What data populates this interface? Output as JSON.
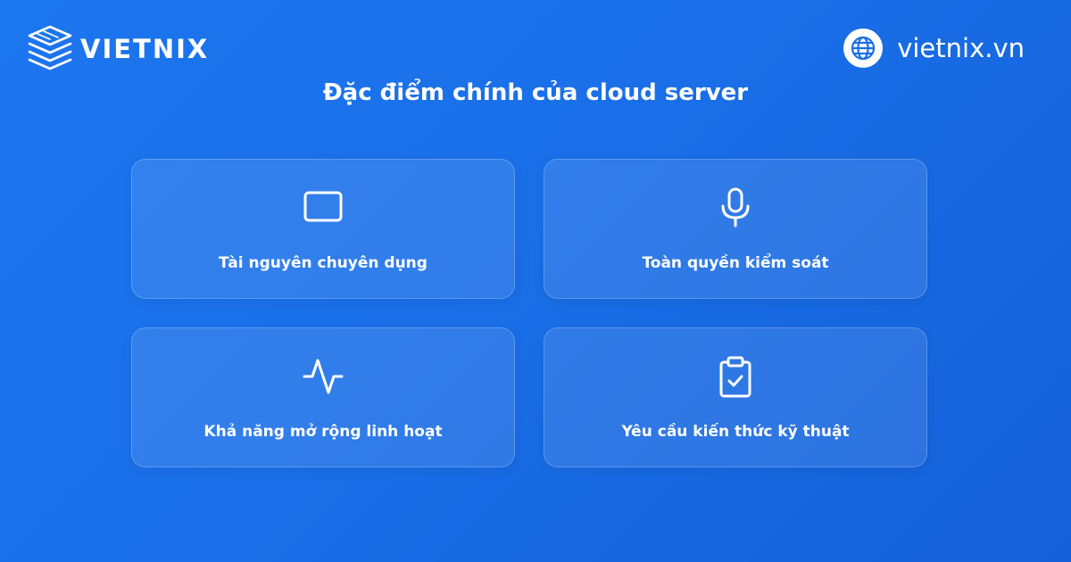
{
  "brand": {
    "name": "VIETNIX",
    "logo_icon": "stacked-server-layers-logo"
  },
  "website": {
    "text": "vietnix.vn",
    "icon": "globe-icon"
  },
  "title": "Đặc điểm chính của cloud server",
  "features": [
    {
      "label": "Tài nguyên chuyên dụng",
      "icon": "monitor-screen-icon"
    },
    {
      "label": "Toàn quyền kiểm soát",
      "icon": "microphone-icon"
    },
    {
      "label": "Khả năng mở rộng linh hoạt",
      "icon": "activity-pulse-icon"
    },
    {
      "label": "Yêu cầu kiến thức kỹ thuật",
      "icon": "clipboard-check-icon"
    }
  ],
  "colors": {
    "background_start": "#1c76ef",
    "background_end": "#1460d8",
    "globe_stroke": "#1a6ee8",
    "text": "#ffffff"
  }
}
